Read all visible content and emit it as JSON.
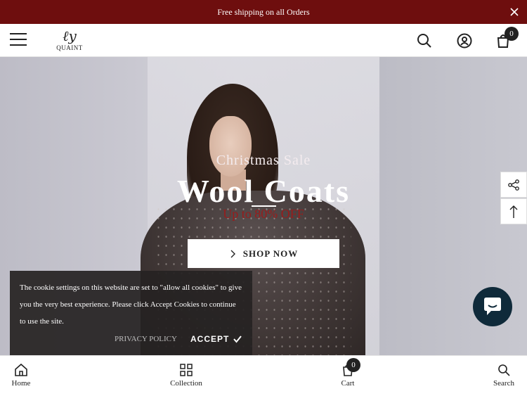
{
  "announcement": {
    "text": "Free shipping on all Orders"
  },
  "header": {
    "logo_mark": "ℓy",
    "logo_text": "QUAINT",
    "cart_count": "0"
  },
  "hero": {
    "subtitle": "Christmas Sale",
    "title": "Wool Coats",
    "offer": "Up to 80% OFF",
    "button_label": "SHOP NOW"
  },
  "cookie_banner": {
    "text": "The cookie settings on this website are set to \"allow all cookies\" to give you the very best experience. Please click Accept Cookies to continue to use the site.",
    "privacy_label": "PRIVACY POLICY",
    "accept_label": "ACCEPT"
  },
  "bottom_nav": {
    "items": [
      {
        "label": "Home",
        "icon": "home-icon"
      },
      {
        "label": "Collection",
        "icon": "grid-icon"
      },
      {
        "label": "Cart",
        "icon": "bag-icon"
      },
      {
        "label": "Search",
        "icon": "search-icon"
      }
    ],
    "cart_count": "0"
  },
  "colors": {
    "announcement_bg": "#6e0e0e",
    "offer_text": "#9a1b1b",
    "chat_bg": "#0f2a3a"
  }
}
